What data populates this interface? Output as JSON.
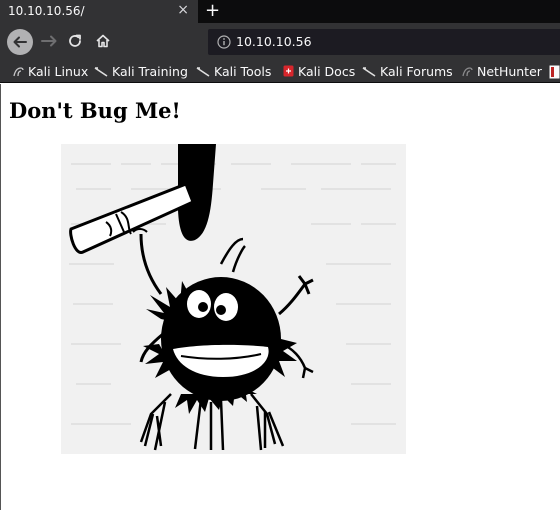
{
  "tab": {
    "title": "10.10.10.56/",
    "close_label": "×",
    "new_tab_label": "+"
  },
  "address_bar": {
    "url": "10.10.10.56"
  },
  "bookmarks": [
    {
      "label": "Kali Linux",
      "icon": "kali-dragon-icon"
    },
    {
      "label": "Kali Training",
      "icon": "kali-dragon-icon"
    },
    {
      "label": "Kali Tools",
      "icon": "kali-dragon-icon"
    },
    {
      "label": "Kali Docs",
      "icon": "kali-docs-icon"
    },
    {
      "label": "Kali Forums",
      "icon": "kali-dragon-icon"
    },
    {
      "label": "NetHunter",
      "icon": "nethunter-icon"
    }
  ],
  "page": {
    "heading": "Don't Bug Me!",
    "image": "cartoon-bug-with-hammer"
  },
  "colors": {
    "chrome": "#323234",
    "tabstrip": "#0c0c0d",
    "urlbar": "#1c1b22",
    "page": "#ffffff"
  }
}
